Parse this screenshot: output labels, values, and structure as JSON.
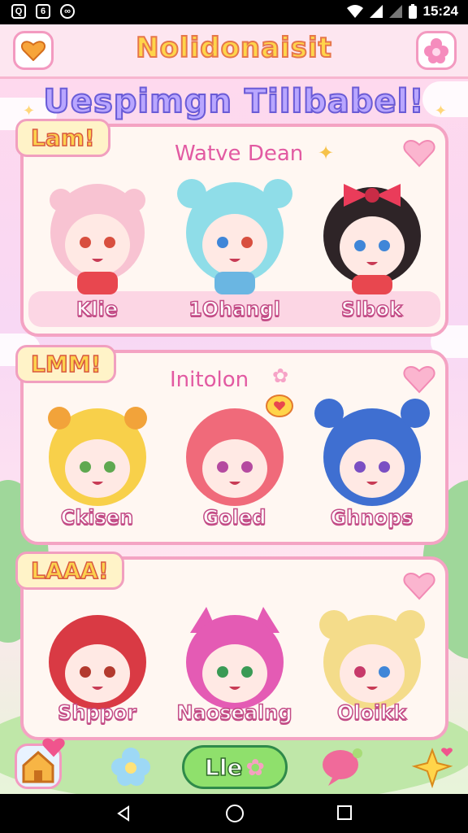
{
  "status_bar": {
    "time": "15:24"
  },
  "header": {
    "title": "Nolidonaisit",
    "left_icon": "heart-icon",
    "right_icon": "flower-icon"
  },
  "banner": {
    "text": "Uespimgn Tillbabel!"
  },
  "sections": [
    {
      "tag": "Lam!",
      "subtitle": "Watve Dean",
      "characters": [
        {
          "name": "Klie"
        },
        {
          "name": "1Ohangl"
        },
        {
          "name": "Slbok"
        }
      ]
    },
    {
      "tag": "LMM!",
      "subtitle": "Initolon",
      "characters": [
        {
          "name": "Ckisen"
        },
        {
          "name": "Goled"
        },
        {
          "name": "Ghnops"
        }
      ]
    },
    {
      "tag": "LAAA!",
      "subtitle": "",
      "characters": [
        {
          "name": "Shppor"
        },
        {
          "name": "Naosealng"
        },
        {
          "name": "Oloikk"
        }
      ]
    }
  ],
  "bottom_nav": {
    "play_label": "Lle",
    "items": [
      "home-icon",
      "flower-icon",
      "play-button",
      "chat-icon",
      "sparkle-icon"
    ]
  },
  "colors": {
    "primary_pink": "#f4a3c3",
    "title_yellow": "#ffd54a",
    "play_green": "#8fe06c"
  }
}
